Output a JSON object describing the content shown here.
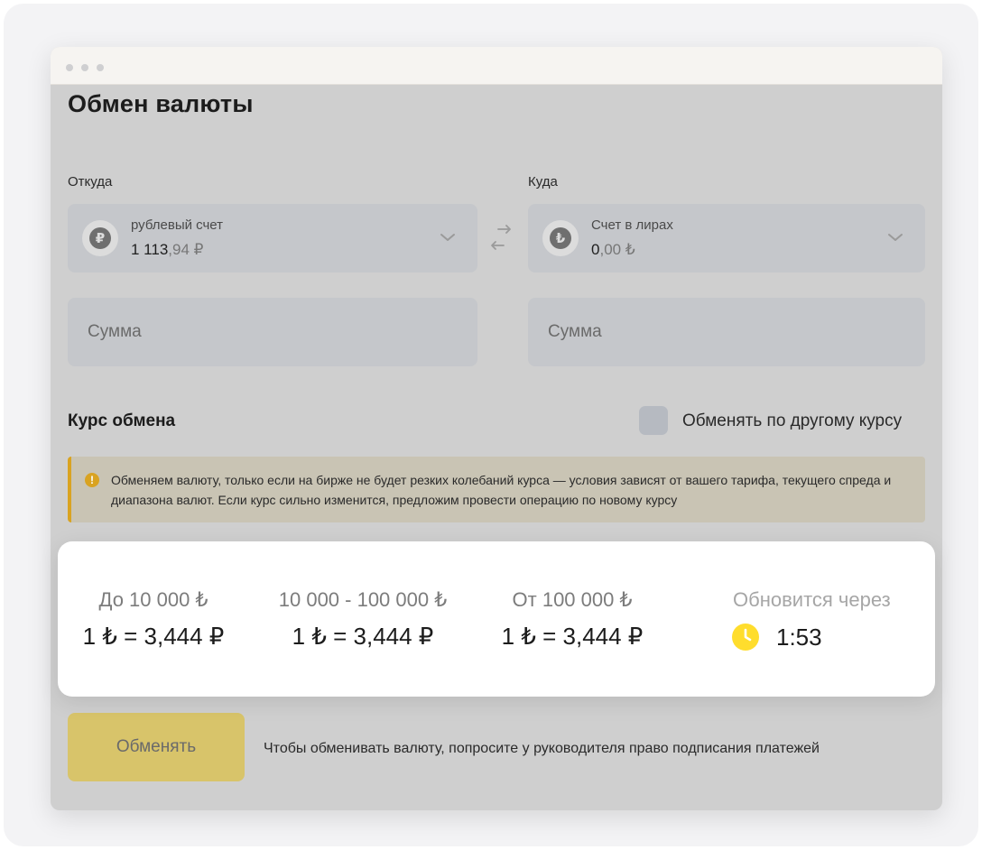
{
  "page": {
    "title": "Обмен валюты"
  },
  "from": {
    "label": "Откуда",
    "account_icon_glyph": "₽",
    "account_name": "рублевый счет",
    "balance_int": "1 113",
    "balance_frac": ",94 ₽",
    "amount_placeholder": "Сумма"
  },
  "to": {
    "label": "Куда",
    "account_icon_glyph": "₺",
    "account_name": "Счет в лирах",
    "balance_int": "0",
    "balance_frac": ",00 ₺",
    "amount_placeholder": "Сумма"
  },
  "rate": {
    "title": "Курс обмена",
    "custom_rate_checkbox_label": "Обменять по другому курсу",
    "custom_rate_checked": false
  },
  "notice": {
    "icon": "exclamation-icon",
    "text": "Обменяем валюту, только если на бирже не будет резких колебаний курса — условия зависят от вашего тарифа, текущего спреда и диапазона валют. Если курс сильно изменится, предложим провести операцию по новому курсу"
  },
  "rates_card": {
    "tiers": [
      {
        "range": "До 10 000 ₺",
        "rate": "1 ₺ = 3,444 ₽"
      },
      {
        "range": "10 000 - 100 000 ₺",
        "rate": "1 ₺ = 3,444 ₽"
      },
      {
        "range": "От 100 000 ₺",
        "rate": "1 ₺ = 3,444 ₽"
      }
    ],
    "update_label": "Обновится через",
    "timer": "1:53"
  },
  "actions": {
    "exchange_button": "Обменять",
    "hint": "Чтобы обменивать валюту, попросите у руководителя право подписания платежей"
  },
  "colors": {
    "accent_yellow": "#FFDD2D",
    "notice_accent": "#D9A321",
    "overlay": "#CFCFCF"
  }
}
